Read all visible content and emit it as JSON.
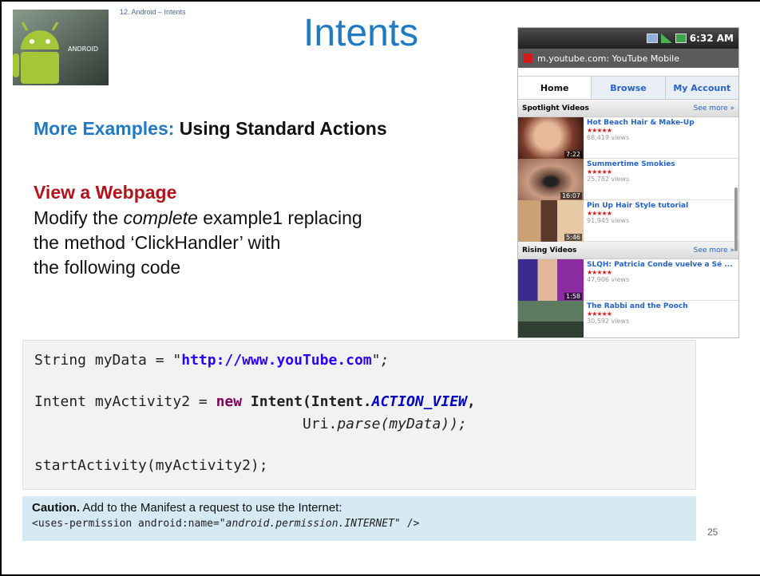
{
  "header": {
    "breadcrumb": "12. Android – Intents",
    "title": "Intents"
  },
  "logo": {
    "text": "ANDROID"
  },
  "heading": {
    "blue_part": "More Examples:",
    "black_part": "Using Standard Actions"
  },
  "section": {
    "title": "View a Webpage",
    "text_1": "Modify the ",
    "text_italic": "complete",
    "text_2": " example1 replacing",
    "line_2": "the method ‘ClickHandler’ with",
    "line_3": "the following code"
  },
  "phone": {
    "time": "6:32 AM",
    "url": "m.youtube.com: YouTube Mobile",
    "tabs": [
      "Home",
      "Browse",
      "My Account"
    ],
    "spotlight_label": "Spotlight Videos",
    "rising_label": "Rising Videos",
    "see_more": "See more »",
    "spotlight_videos": [
      {
        "title": "Hot Beach Hair & Make-Up",
        "views": "68,419 views",
        "duration": "7:22"
      },
      {
        "title": "Summertime Smokies",
        "views": "25,782 views",
        "duration": "16:07"
      },
      {
        "title": "Pin Up Hair Style tutorial",
        "views": "91,945 views",
        "duration": "5:46"
      }
    ],
    "rising_videos": [
      {
        "title": "SLQH: Patricia Conde vuelve a Sé ...",
        "views": "47,906 views",
        "duration": "1:58"
      },
      {
        "title": "The Rabbi and the Pooch",
        "views": "30,592 views",
        "duration": ""
      }
    ],
    "stars": "★★★★★"
  },
  "code": {
    "l1_a": "String myData = ",
    "l1_q1": "\"",
    "l1_str": "http://www.youTube.com",
    "l1_q2": "\";",
    "l2_a": "Intent myActivity2 = ",
    "l2_new": "new",
    "l2_b": " Intent(Intent.",
    "l2_const": "ACTION_VIEW",
    "l2_c": ",",
    "l3_indent": "                               ",
    "l3_a": "Uri.",
    "l3_parse": "parse(myData));",
    "l4": "startActivity(myActivity2);"
  },
  "caution": {
    "label": "Caution.",
    "text": " Add to the Manifest a request to use the Internet:",
    "code_a": "<uses-permission android:name=\"",
    "code_ital": "android.permission.INTERNET",
    "code_b": "\" />"
  },
  "page_number": "25"
}
